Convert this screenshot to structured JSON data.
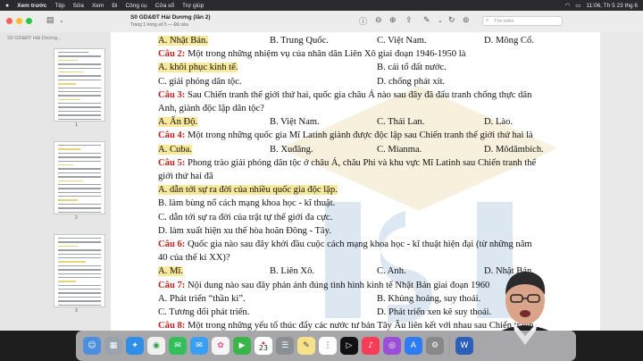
{
  "menubar": {
    "items": [
      "Xem trước",
      "Tệp",
      "Sửa",
      "Xem",
      "Đi",
      "Công cụ",
      "Cửa sổ",
      "Trợ giúp"
    ],
    "clock": "11:06, Th 5 23 thg 6"
  },
  "toolbar": {
    "title": "S0 GD&ĐT Hải Dương (lần 2)",
    "subtitle": "Trang 1 trong số 5 — Đã sửa",
    "search_placeholder": "Tìm kiếm"
  },
  "sidebar": {
    "title": "S0 GD&ĐT Hải Dương...",
    "pages": [
      "1",
      "2",
      "3"
    ]
  },
  "document": {
    "lines": [
      {
        "segments": [
          {
            "t": "A. Nhật Bản.",
            "hl": true
          }
        ],
        "opts": [
          {
            "t": "B. Trung Quốc."
          },
          {
            "t": "C. Việt Nam."
          },
          {
            "t": "D. Mông Cổ."
          }
        ]
      },
      {
        "q": "Câu 2:",
        "text": " Một trong những nhiệm vụ của nhân dân Liên Xô giai đoạn 1946-1950 là"
      },
      {
        "segments": [
          {
            "t": "A. khôi phục kinh tế.",
            "hl": true
          }
        ],
        "opts2": [
          {
            "t": "B. cải tổ đất nước."
          }
        ]
      },
      {
        "segments": [
          {
            "t": "C. giải phóng dân tộc."
          }
        ],
        "opts2": [
          {
            "t": "D. chống phát xít."
          }
        ]
      },
      {
        "q": "Câu 3:",
        "text": " Sau Chiến tranh thế giới thứ hai, quốc gia châu Á nào sau đây đã đấu tranh chống thực dân"
      },
      {
        "text": "Anh, giành độc lập dân tộc?"
      },
      {
        "segments": [
          {
            "t": "A. Ấn Độ.",
            "hl": true
          }
        ],
        "opts": [
          {
            "t": "B. Việt Nam."
          },
          {
            "t": "C. Thái Lan."
          },
          {
            "t": "D. Lào."
          }
        ]
      },
      {
        "q": "Câu 4:",
        "text": " Một trong những quốc gia Mĩ Latinh giành được độc lập sau Chiến tranh thế giới thứ hai là"
      },
      {
        "segments": [
          {
            "t": "A. Cuba.",
            "hl": true
          }
        ],
        "opts": [
          {
            "t": "B. Xuđăng."
          },
          {
            "t": "C. Mianma."
          },
          {
            "t": "D. Môdămbích."
          }
        ]
      },
      {
        "q": "Câu 5:",
        "text": " Phong trào giải phóng dân tộc ở châu Á, châu Phi và khu vực Mĩ Latinh sau Chiến tranh thế"
      },
      {
        "text": "giới thứ hai đã"
      },
      {
        "segments": [
          {
            "t": "A. dẫn tới sự ra đời của nhiều quốc gia độc lập.",
            "hl": true
          }
        ]
      },
      {
        "segments": [
          {
            "t": "B. làm bùng nổ cách mạng khoa học - kĩ thuật."
          }
        ]
      },
      {
        "segments": [
          {
            "t": "C. dẫn tới sự ra đời của trật tự thế giới đa cực."
          }
        ]
      },
      {
        "segments": [
          {
            "t": "D. làm xuất hiện xu thế hòa hoãn Đông - Tây."
          }
        ]
      },
      {
        "q": "Câu 6:",
        "text": " Quốc gia nào sau đây khởi đầu cuộc cách mạng khoa học - kĩ thuật hiện đại (từ những năm"
      },
      {
        "text": "40 của thế kỉ XX)?"
      },
      {
        "segments": [
          {
            "t": "A. Mĩ.",
            "hl": true
          }
        ],
        "opts": [
          {
            "t": "B. Liên Xô."
          },
          {
            "t": "C. Anh."
          },
          {
            "t": "D. Nhật Bản."
          }
        ]
      },
      {
        "q": "Câu 7:",
        "text": " Nội dung nào sau đây phản ánh đúng tình hình kinh tế Nhật Bản giai đoạn 1960"
      },
      {
        "segments": [
          {
            "t": "A. Phát triển “thần kì”."
          }
        ],
        "opts2": [
          {
            "t": "B. Khủng hoảng, suy thoái."
          }
        ]
      },
      {
        "segments": [
          {
            "t": "C. Tương đối phát triển."
          }
        ],
        "opts2": [
          {
            "t": "D. Phát triển xen kẽ suy thoái."
          }
        ]
      },
      {
        "q": "Câu 8:",
        "text": " Một trong những yếu tố thúc đẩy các nước tư bản Tây Âu liên kết với nhau sau Chiến tranh"
      }
    ]
  },
  "dock": {
    "calendar_day": "23"
  }
}
